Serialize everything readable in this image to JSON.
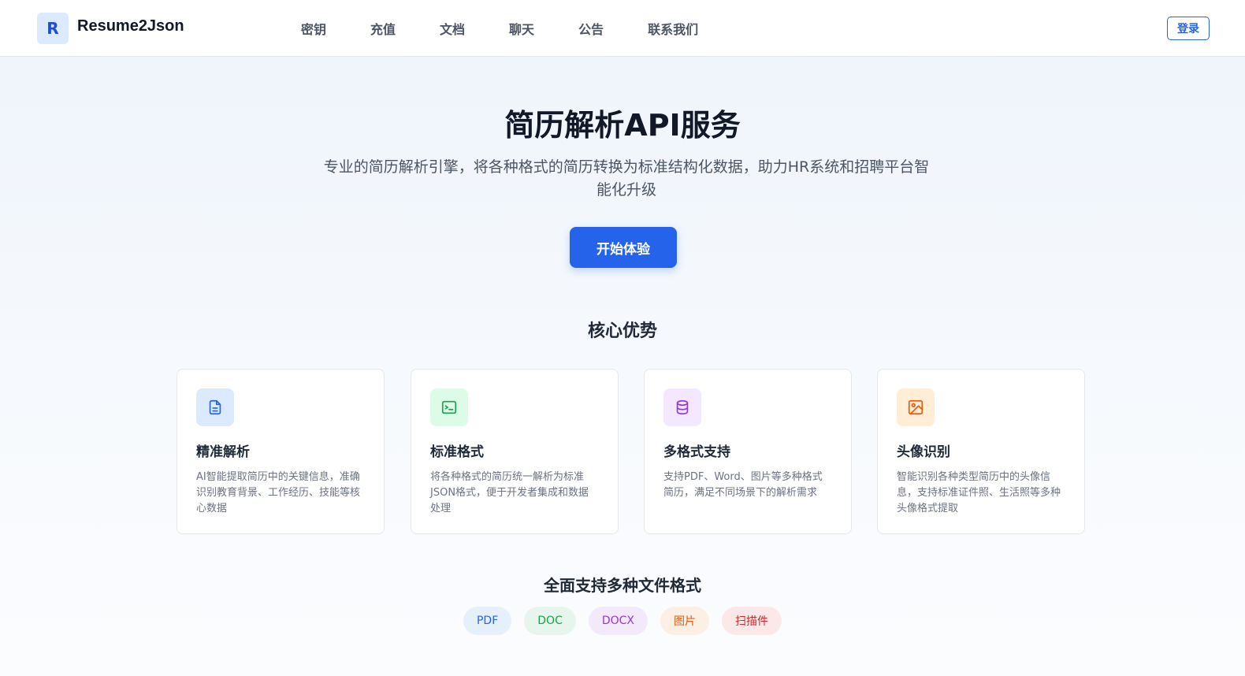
{
  "header": {
    "logo_letter": "R",
    "brand": "Resume2Json",
    "nav": [
      "密钥",
      "充值",
      "文档",
      "聊天",
      "公告",
      "联系我们"
    ],
    "login": "登录"
  },
  "hero": {
    "title": "简历解析API服务",
    "subtitle": "专业的简历解析引擎，将各种格式的简历转换为标准结构化数据，助力HR系统和招聘平台智能化升级",
    "cta": "开始体验"
  },
  "features": {
    "title": "核心优势",
    "cards": [
      {
        "icon": "document-icon",
        "color": "#2563eb",
        "bg": "#dbeafe",
        "title": "精准解析",
        "desc": "AI智能提取简历中的关键信息，准确识别教育背景、工作经历、技能等核心数据"
      },
      {
        "icon": "terminal-icon",
        "color": "#16a34a",
        "bg": "#dcfce7",
        "title": "标准格式",
        "desc": "将各种格式的简历统一解析为标准JSON格式，便于开发者集成和数据处理"
      },
      {
        "icon": "database-icon",
        "color": "#9333ea",
        "bg": "#f3e8ff",
        "title": "多格式支持",
        "desc": "支持PDF、Word、图片等多种格式简历，满足不同场景下的解析需求"
      },
      {
        "icon": "image-icon",
        "color": "#ea580c",
        "bg": "#ffedd5",
        "title": "头像识别",
        "desc": "智能识别各种类型简历中的头像信息，支持标准证件照、生活照等多种头像格式提取"
      }
    ]
  },
  "formats": {
    "title": "全面支持多种文件格式",
    "items": [
      {
        "label": "PDF",
        "color": "#2563eb",
        "bg": "#e6effc"
      },
      {
        "label": "DOC",
        "color": "#16a34a",
        "bg": "#e6f6ec"
      },
      {
        "label": "DOCX",
        "color": "#9333ea",
        "bg": "#f2eafb"
      },
      {
        "label": "图片",
        "color": "#ea580c",
        "bg": "#fcefe3"
      },
      {
        "label": "扫描件",
        "color": "#dc2626",
        "bg": "#fce8e8"
      }
    ]
  }
}
